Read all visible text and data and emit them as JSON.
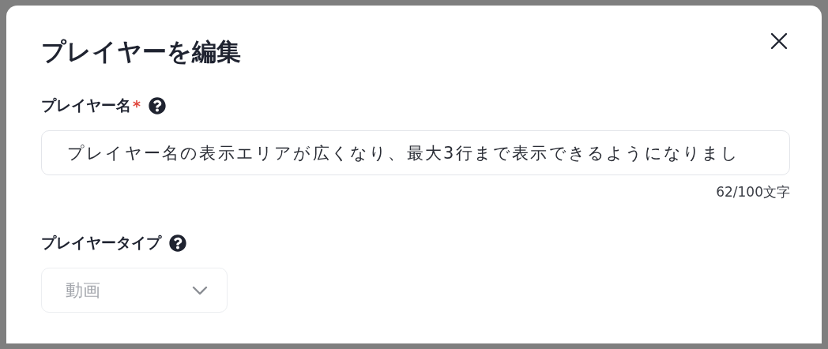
{
  "dialog": {
    "title": "プレイヤーを編集"
  },
  "name_field": {
    "label": "プレイヤー名",
    "required_mark": "*",
    "value": "プレイヤー名の表示エリアが広くなり、最大3行まで表示できるようになりまし",
    "counter": "62/100文字"
  },
  "type_field": {
    "label": "プレイヤータイプ",
    "value": "動画",
    "disabled": true
  }
}
